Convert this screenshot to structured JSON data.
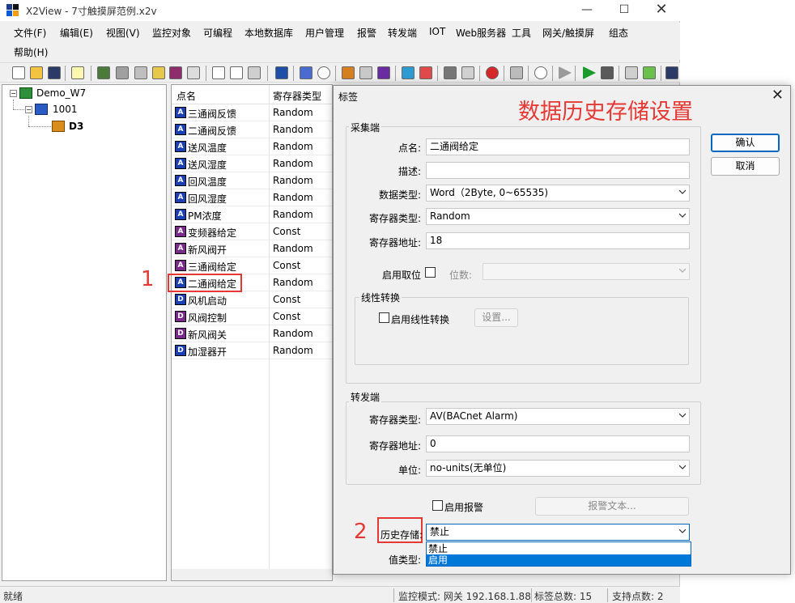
{
  "window": {
    "title": "X2View - 7寸触摸屏范例.x2v",
    "min_glyph": "—",
    "max_glyph": "☐",
    "close_glyph": "✕"
  },
  "menu": [
    "文件(F)",
    "编辑(E)",
    "视图(V)",
    "监控对象",
    "可编程",
    "本地数据库",
    "用户管理",
    "报警",
    "转发端",
    "IOT",
    "Web服务器",
    "工具",
    "网关/触摸屏",
    "组态",
    "帮助(H)"
  ],
  "tree": {
    "root": "Demo_W7",
    "child": "1001",
    "leaf": "D3"
  },
  "list": {
    "col_name": "点名",
    "col_type": "寄存器类型",
    "rows": [
      {
        "icon": "A",
        "name": "三通阀反馈",
        "type": "Random"
      },
      {
        "icon": "A",
        "name": "二通阀反馈",
        "type": "Random"
      },
      {
        "icon": "A",
        "name": "送风温度",
        "type": "Random"
      },
      {
        "icon": "A",
        "name": "送风湿度",
        "type": "Random"
      },
      {
        "icon": "A",
        "name": "回风温度",
        "type": "Random"
      },
      {
        "icon": "A",
        "name": "回风湿度",
        "type": "Random"
      },
      {
        "icon": "A",
        "name": "PM浓度",
        "type": "Random"
      },
      {
        "icon": "A",
        "name": "变频器给定",
        "type": "Const"
      },
      {
        "icon": "A",
        "name": "新风阀开",
        "type": "Random"
      },
      {
        "icon": "A",
        "name": "三通阀给定",
        "type": "Const"
      },
      {
        "icon": "A",
        "name": "二通阀给定",
        "type": "Random"
      },
      {
        "icon": "D",
        "name": "风机启动",
        "type": "Const"
      },
      {
        "icon": "D",
        "name": "风阀控制",
        "type": "Const"
      },
      {
        "icon": "D",
        "name": "新风阀关",
        "type": "Random"
      },
      {
        "icon": "D",
        "name": "加湿器开",
        "type": "Random"
      }
    ]
  },
  "annotations": {
    "marker1": "1",
    "marker2": "2",
    "overlay_title": "数据历史存储设置"
  },
  "status": {
    "ready": "就绪",
    "mode": "监控模式: 网关 192.168.1.88",
    "tag_count": "标签总数: 15",
    "support": "支持点数: 2"
  },
  "dialog": {
    "title": "标签",
    "close_glyph": "✕",
    "ok_label": "确认",
    "cancel_label": "取消",
    "collect": {
      "group_label": "采集端",
      "name_label": "点名:",
      "name_value": "二通阀给定",
      "desc_label": "描述:",
      "desc_value": "",
      "dtype_label": "数据类型:",
      "dtype_value": "Word（2Byte, 0~65535)",
      "rtype_label": "寄存器类型:",
      "rtype_value": "Random",
      "raddr_label": "寄存器地址:",
      "raddr_value": "18",
      "bit_enable_label": "启用取位",
      "bit_label": "位数:",
      "bit_value": ""
    },
    "linear": {
      "group_label": "线性转换",
      "enable_label": "启用线性转换",
      "settings_label": "设置..."
    },
    "forward": {
      "group_label": "转发端",
      "rtype_label": "寄存器类型:",
      "rtype_value": "AV(BACnet Alarm)",
      "raddr_label": "寄存器地址:",
      "raddr_value": "0",
      "unit_label": "单位:",
      "unit_value": "no-units(无单位)"
    },
    "alarm_enable_label": "启用报警",
    "alarm_text_label": "报警文本...",
    "history_label": "历史存储:",
    "history_value": "禁止",
    "history_options": [
      "禁止",
      "启用"
    ],
    "value_type_label": "值类型:"
  }
}
